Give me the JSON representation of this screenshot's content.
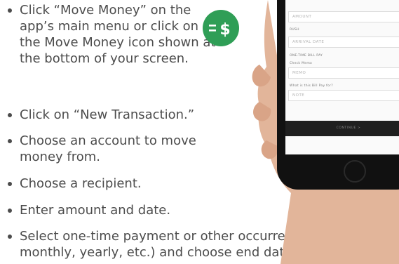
{
  "instructions": [
    "Click “Move Money” on the app’s main menu or click on the Move Money icon shown at  the bottom of your screen.",
    "Click on “New Transaction.”",
    "Choose an account to move money from.",
    "Choose a recipient.",
    "Enter amount and date.",
    "Select one-time payment or other occurrence (weekly, monthly, yearly, etc.) and choose end date."
  ],
  "icon": {
    "name": "move-money-icon",
    "glyph": "=$",
    "color": "#2f9e56"
  },
  "phone_screen": {
    "amount_placeholder": "AMOUNT",
    "rush_label": "RUSH",
    "arrival_date_placeholder": "ARRIVAL DATE",
    "bill_pay_label": "ONE-TIME BILL PAY",
    "check_memo_label": "Check Memo",
    "memo_placeholder": "MEMO",
    "bill_for_label": "What is this Bill Pay for?",
    "note_placeholder": "NOTE",
    "continue_label": "CONTINUE  >"
  }
}
